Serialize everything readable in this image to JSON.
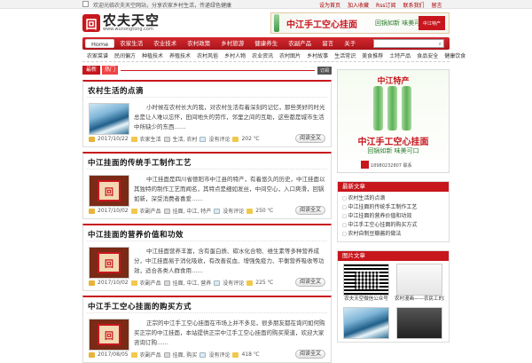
{
  "topbar": {
    "tagline": "欢迎光临农夫天空网站，分享农家乡村生活，传递绿色健康",
    "links": [
      "设为首页",
      "加入收藏",
      "Rss订阅",
      "联系我们",
      "留言"
    ]
  },
  "logo": {
    "text": "农夫天空",
    "url": "www.wunongtong.com"
  },
  "banner_top": {
    "title": "中江手工空心挂面",
    "slogan": "回锅如新 味美可口",
    "badge": "中江特产"
  },
  "nav": {
    "home": "Home",
    "items": [
      "农家生活",
      "农业技术",
      "农村政策",
      "乡村旅游",
      "健康养生",
      "农副产品",
      "留言",
      "关于"
    ],
    "search_placeholder": ""
  },
  "subnav": [
    "农家菜谱",
    "民间偏方",
    "种植技术",
    "养殖技术",
    "农村风俗",
    "乡村人物",
    "农业资讯",
    "农村图片",
    "乡村故事",
    "生活常识",
    "美食推荐",
    "土特产品",
    "食品安全",
    "健康饮食"
  ],
  "crumb": {
    "tab": "最新",
    "tab2": "热门",
    "rss": "订阅"
  },
  "posts": [
    {
      "title": "农村生活的点滴",
      "excerpt": "小时候在农村长大的我，对农村生活有着深刻的记忆，那些美好的时光总是让人难以忘怀，田间地头的劳作，邻里之间的互助，这些都是城市生活中所缺少的东西……",
      "thumb": "wave",
      "date": "2017/10/22",
      "category": "农家生活",
      "tags": "生活, 农村",
      "comments": "没有评论",
      "views": "202 ℃",
      "more": "阅读全文"
    },
    {
      "title": "中江挂面的传统手工制作工艺",
      "excerpt": "中江挂面是四川省德阳市中江县的特产，有着悠久的历史，中江挂面以其独特的制作工艺而闻名，其特点是细如发丝，中间空心，入口爽滑，回锅如新，深受消费者喜爱……",
      "thumb": "seal",
      "date": "2017/10/02",
      "category": "农副产品",
      "tags": "挂面, 中江, 特产",
      "comments": "没有评论",
      "views": "250 ℃",
      "more": "阅读全文"
    },
    {
      "title": "中江挂面的营养价值和功效",
      "excerpt": "中江挂面营养丰富，含有蛋白质、碳水化合物、维生素等多种营养成分，中江挂面易于消化吸收，有改善贫血、增强免疫力、平衡营养吸收等功效，适合各类人群食用……",
      "thumb": "seal",
      "date": "2017/10/02",
      "category": "农副产品",
      "tags": "挂面, 中江, 营养",
      "comments": "没有评论",
      "views": "225 ℃",
      "more": "阅读全文"
    },
    {
      "title": "中江手工空心挂面的购买方式",
      "excerpt": "正宗的中江手工空心挂面在市场上并不多见，很多朋友都在询问如何购买正宗的中江挂面，本站提供正宗中江手工空心挂面的购买渠道，欢迎大家咨询订购……",
      "thumb": "seal",
      "date": "2017/08/05",
      "category": "农副产品",
      "tags": "挂面, 购买",
      "comments": "没有评论",
      "views": "418 ℃",
      "more": "阅读全文"
    }
  ],
  "side_ad": {
    "head": "中江特产",
    "title": "中江手工空心挂面",
    "slogan": "回锅如新 味美可口",
    "phone": "18980232807 联系"
  },
  "recent": {
    "title": "最新文章",
    "items": [
      "农村生活的点滴",
      "中江挂面的传统手工制作工艺",
      "中江挂面的营养价值和功效",
      "中江手工空心挂面的购买方式",
      "农村自制豆瓣酱的做法"
    ]
  },
  "gallery": {
    "title": "图片文章",
    "items": [
      {
        "img": "qr",
        "caption": "农夫天空微信公众号"
      },
      {
        "img": "sketch",
        "caption": "农村漫画——农民工的艰辛"
      },
      {
        "img": "wave",
        "caption": ""
      },
      {
        "img": "dark",
        "caption": ""
      }
    ]
  }
}
